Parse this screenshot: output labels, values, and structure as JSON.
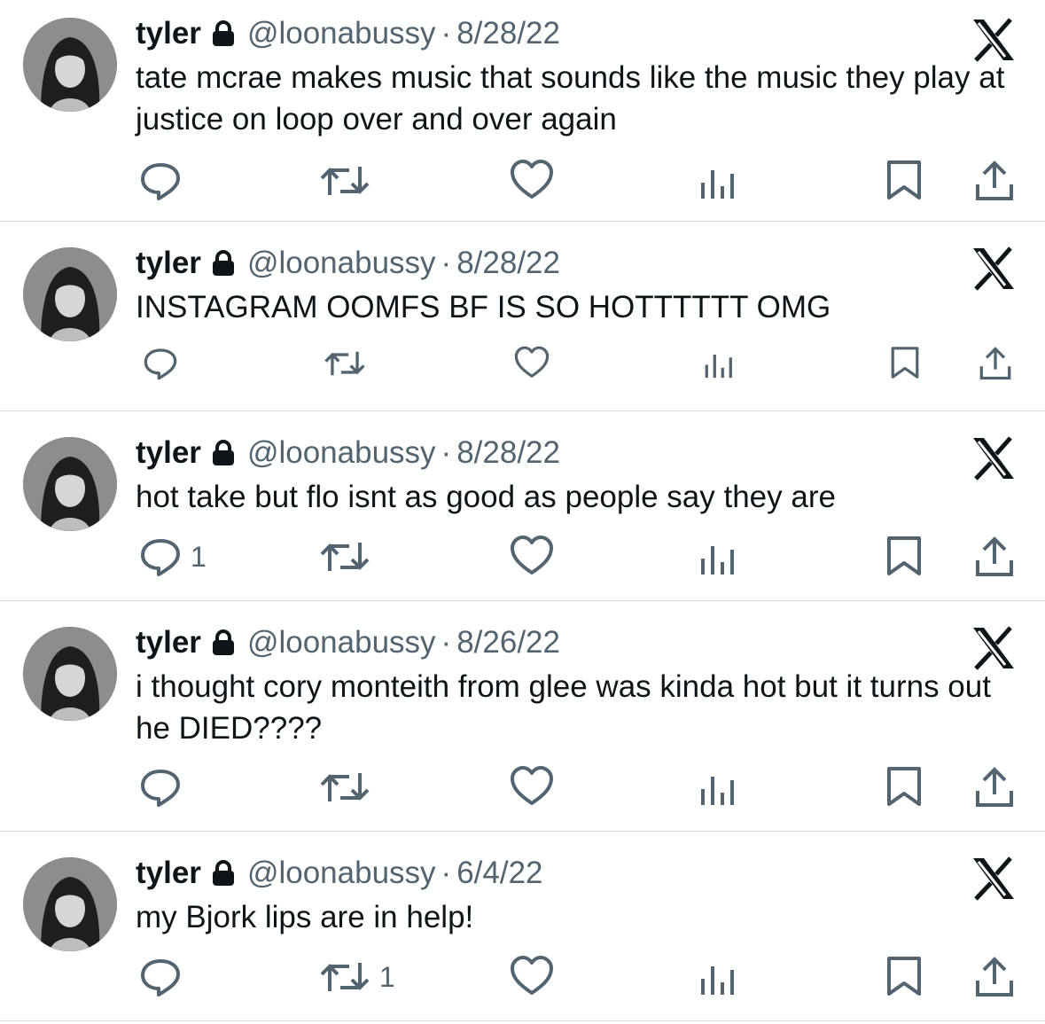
{
  "colors": {
    "text": "#0f1419",
    "muted": "#536471",
    "divider": "#d9dde1"
  },
  "tweets": [
    {
      "name": "tyler",
      "handle": "@loonabussy",
      "separator": "·",
      "date": "8/28/22",
      "text": "tate mcrae makes music that sounds like the music they play at justice on loop over and over again",
      "replies": "",
      "retweets": "",
      "likes": "",
      "views": ""
    },
    {
      "name": "tyler",
      "handle": "@loonabussy",
      "separator": "·",
      "date": "8/28/22",
      "text": "INSTAGRAM OOMFS BF IS SO HOTTTTTT OMG",
      "replies": "",
      "retweets": "",
      "likes": "",
      "views": ""
    },
    {
      "name": "tyler",
      "handle": "@loonabussy",
      "separator": "·",
      "date": "8/28/22",
      "text": "hot take but flo isnt as good as people say they are",
      "replies": "1",
      "retweets": "",
      "likes": "",
      "views": ""
    },
    {
      "name": "tyler",
      "handle": "@loonabussy",
      "separator": "·",
      "date": "8/26/22",
      "text": "i thought cory monteith from glee was kinda hot but it turns out he DIED????",
      "replies": "",
      "retweets": "",
      "likes": "",
      "views": ""
    },
    {
      "name": "tyler",
      "handle": "@loonabussy",
      "separator": "·",
      "date": "6/4/22",
      "text": "my Bjork lips are in help!",
      "replies": "",
      "retweets": "1",
      "likes": "",
      "views": ""
    }
  ]
}
